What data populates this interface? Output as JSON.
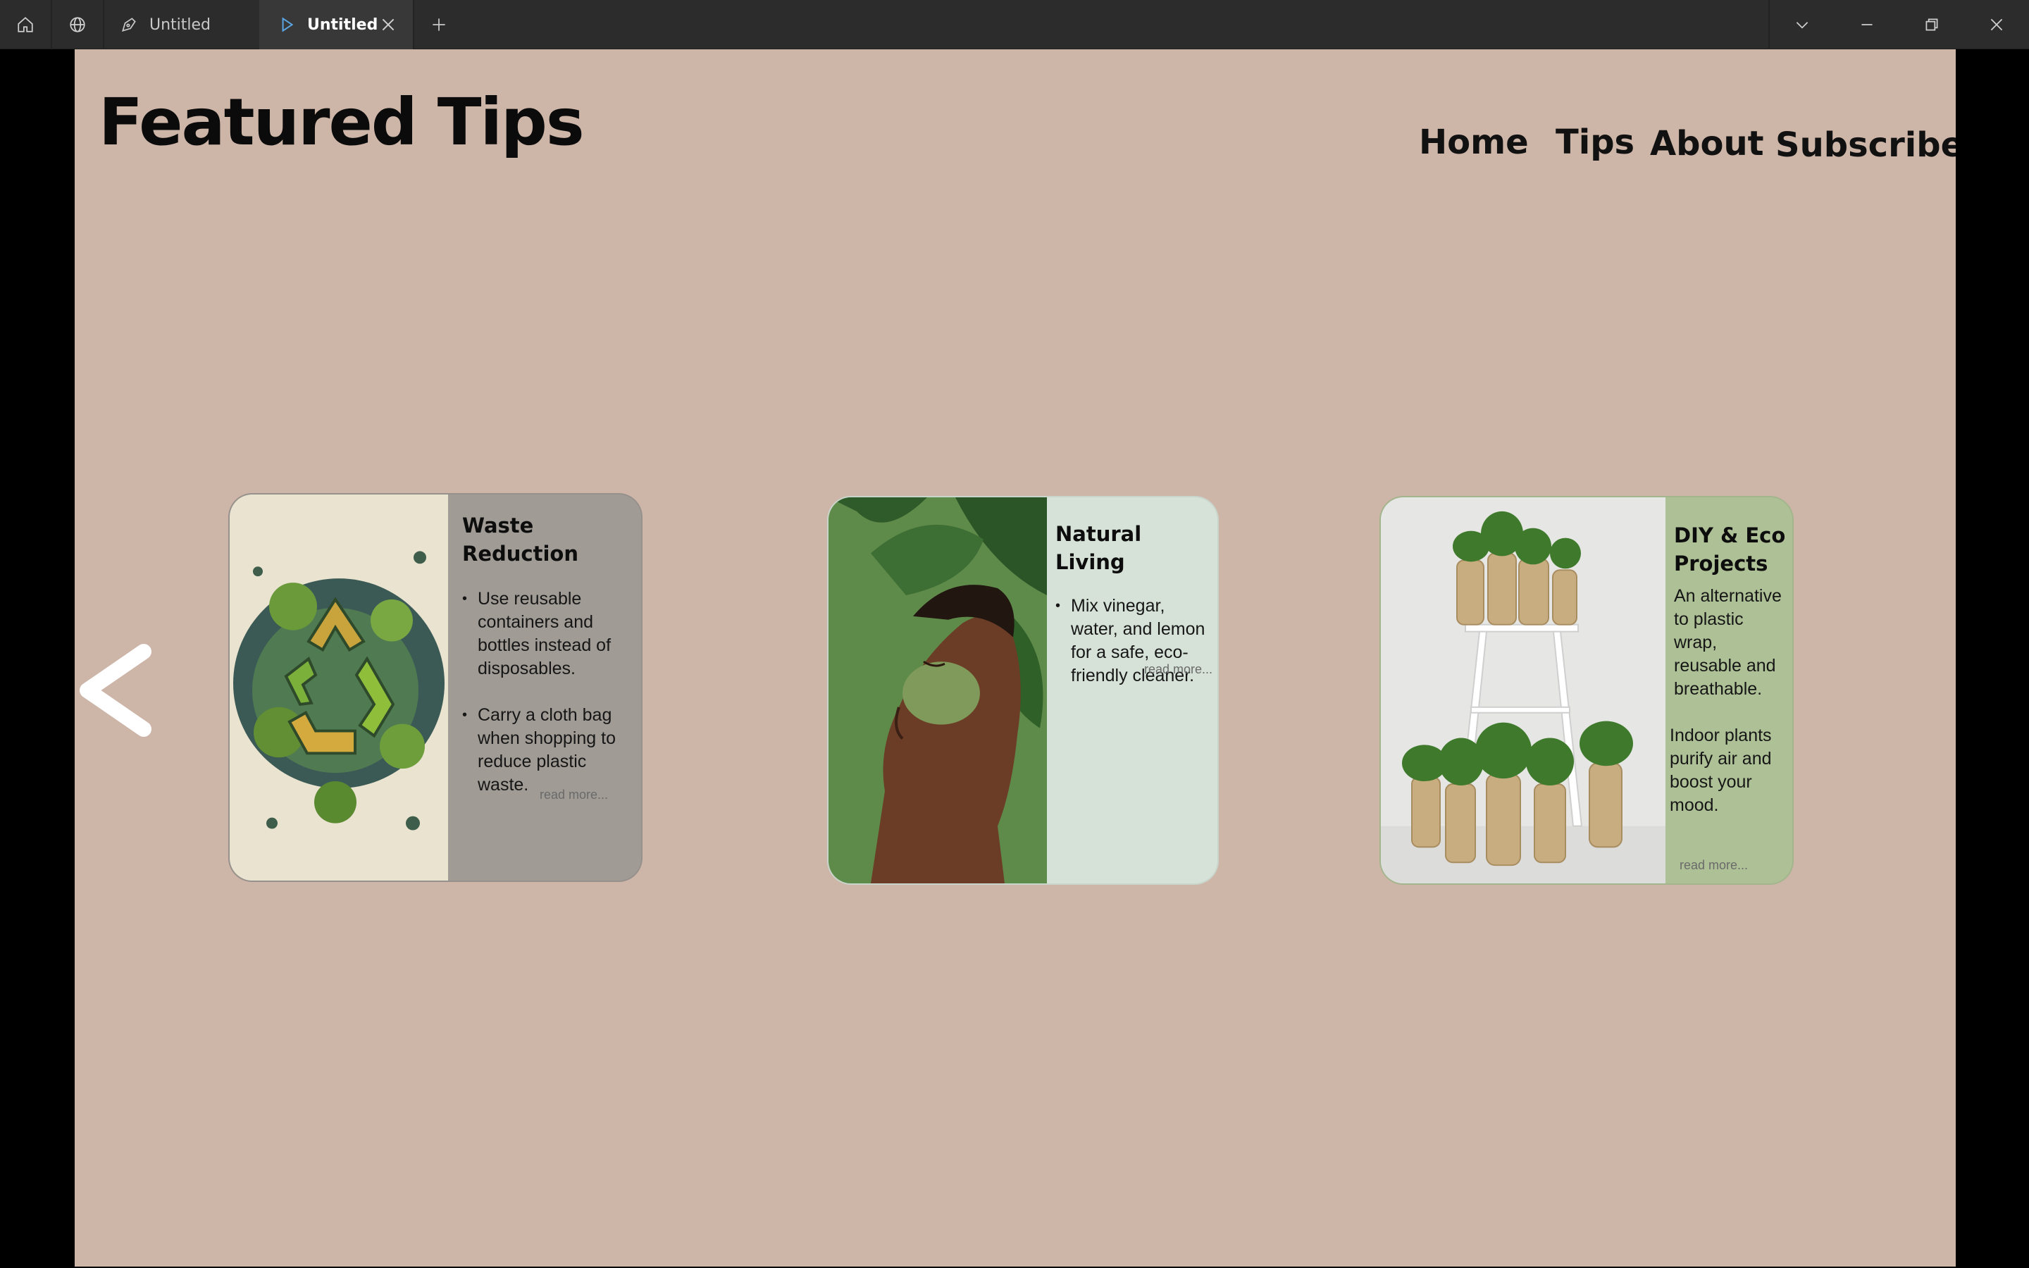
{
  "titlebar": {
    "tabs": [
      {
        "label": "Untitled",
        "icon": "pen-tool-icon",
        "active": false
      },
      {
        "label": "Untitled",
        "icon": "play-icon",
        "active": true
      }
    ]
  },
  "page": {
    "title": "Featured Tips",
    "nav": [
      "Home",
      "Tips",
      "About",
      "Subscribe"
    ],
    "background": "#cdb5a8"
  },
  "cards": [
    {
      "title": "Waste Reduction",
      "image": "recycle-leaves-image",
      "bullets": [
        "Use reusable containers and bottles instead of disposables.",
        "Carry a cloth bag when shopping to reduce plastic waste."
      ],
      "read_more": "read more...",
      "color": "#a09b95"
    },
    {
      "title": "Natural Living",
      "image": "face-mask-leaves-image",
      "bullets": [
        "Mix vinegar, water, and lemon for a safe, eco-friendly cleaner."
      ],
      "read_more": "read more...",
      "color": "#d6e2d8"
    },
    {
      "title": "DIY & Eco Projects",
      "image": "potted-plants-stand-image",
      "paragraphs": [
        "An alternative to plastic wrap, reusable and breathable.",
        "Indoor plants purify air and boost your mood."
      ],
      "read_more": "read more...",
      "color": "#aec196"
    }
  ]
}
